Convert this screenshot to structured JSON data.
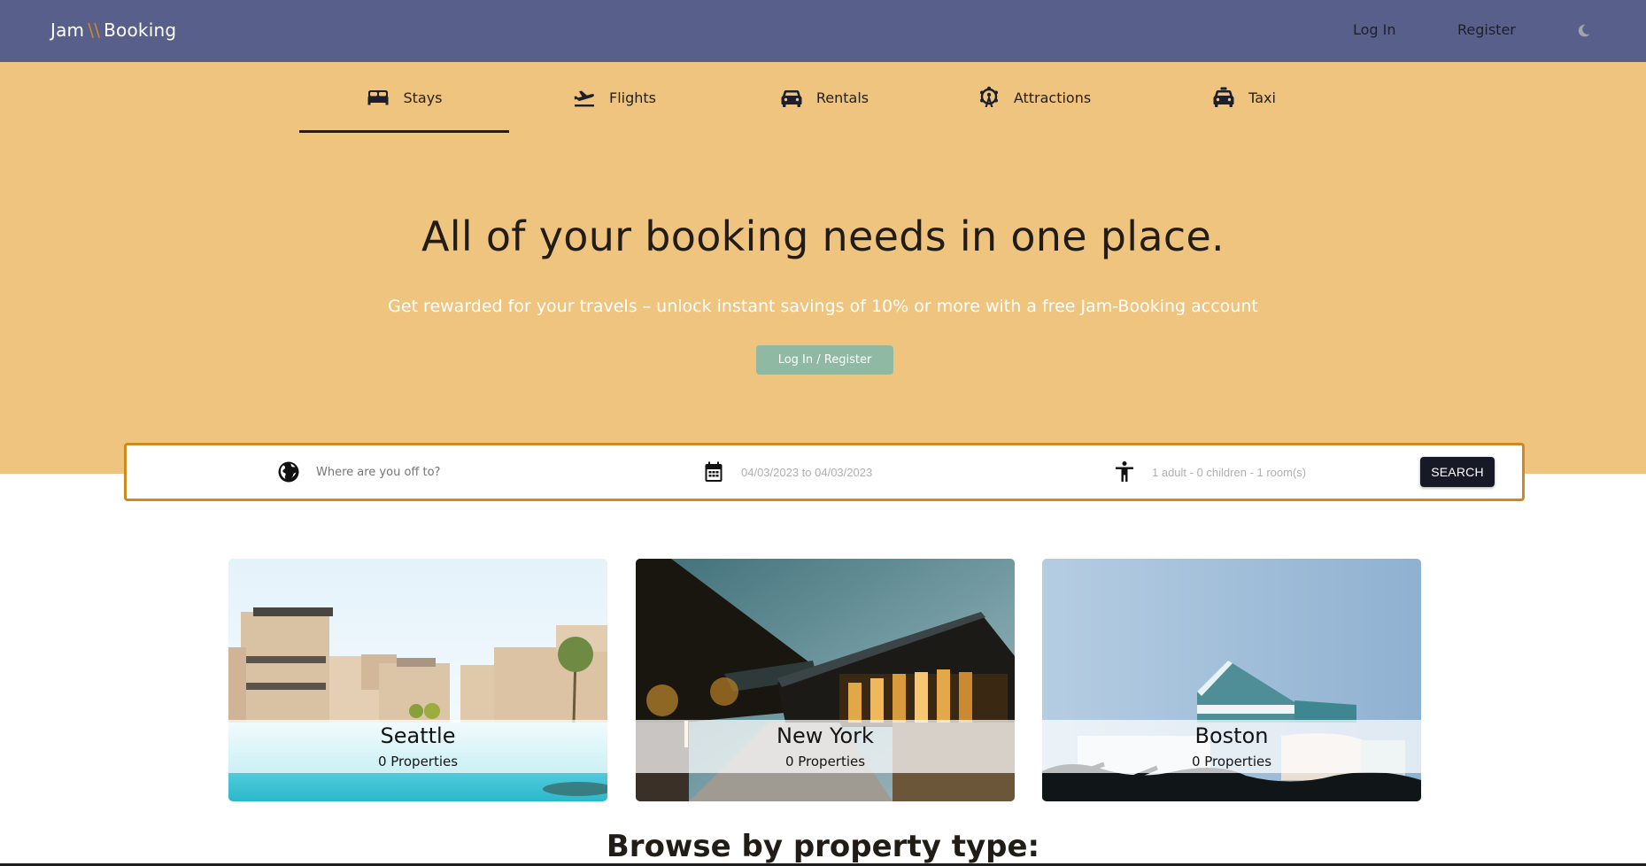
{
  "navbar": {
    "brand_left": "Jam",
    "brand_slashes": "\\\\",
    "brand_right": "Booking",
    "login_label": "Log In",
    "register_label": "Register",
    "theme_icon": "moon-icon"
  },
  "colors": {
    "navbar_bg": "#585f8a",
    "hero_bg": "#efc47f",
    "accent_orange": "#cf8a1f",
    "cta_green": "#8fb9a3",
    "search_button": "#171a26"
  },
  "tabs": [
    {
      "label": "Stays",
      "icon": "bed-icon",
      "active": true
    },
    {
      "label": "Flights",
      "icon": "plane-departure-icon",
      "active": false
    },
    {
      "label": "Rentals",
      "icon": "car-icon",
      "active": false
    },
    {
      "label": "Attractions",
      "icon": "ferris-wheel-icon",
      "active": false
    },
    {
      "label": "Taxi",
      "icon": "taxi-icon",
      "active": false
    }
  ],
  "hero": {
    "title": "All of your booking needs in one place.",
    "subtitle": "Get rewarded for your travels – unlock instant savings of 10% or more with a free Jam-Booking account",
    "cta_label": "Log In / Register"
  },
  "search": {
    "destination_placeholder": "Where are you off to?",
    "destination_value": "",
    "date_range": "04/03/2023 to 04/03/2023",
    "guests": "1 adult - 0 children - 1 room(s)",
    "button_label": "SEARCH"
  },
  "cities": [
    {
      "name": "Seattle",
      "properties": "0 Properties"
    },
    {
      "name": "New York",
      "properties": "0 Properties"
    },
    {
      "name": "Boston",
      "properties": "0 Properties"
    }
  ],
  "browse": {
    "title": "Browse by property type:"
  }
}
